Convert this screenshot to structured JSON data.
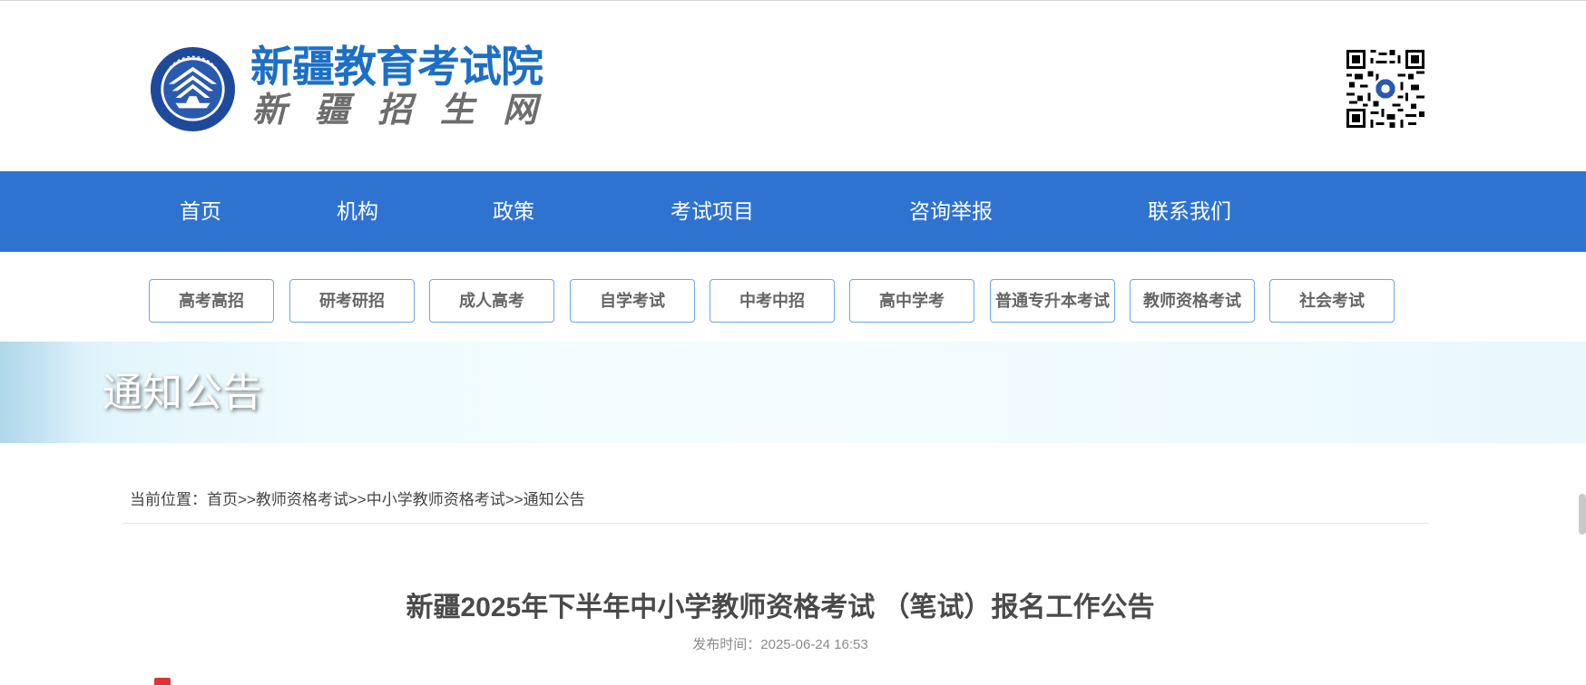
{
  "header": {
    "site_title": "新疆教育考试院",
    "site_subtitle": "新疆招生网",
    "emblem_icon": "exam-institute-emblem-icon",
    "qr_icon": "qr-code-icon"
  },
  "nav": {
    "items": [
      {
        "label": "首页"
      },
      {
        "label": "机构"
      },
      {
        "label": "政策"
      },
      {
        "label": "考试项目"
      },
      {
        "label": "咨询举报"
      },
      {
        "label": "联系我们"
      }
    ],
    "bg_color": "#2f73d1"
  },
  "categories": [
    {
      "label": "高考高招"
    },
    {
      "label": "研考研招"
    },
    {
      "label": "成人高考"
    },
    {
      "label": "自学考试"
    },
    {
      "label": "中考中招"
    },
    {
      "label": "高中学考"
    },
    {
      "label": "普通专升本考试"
    },
    {
      "label": "教师资格考试"
    },
    {
      "label": "社会考试"
    }
  ],
  "banner": {
    "title": "通知公告"
  },
  "breadcrumb": {
    "prefix": "当前位置：",
    "sep": ">>",
    "items": [
      "首页",
      "教师资格考试",
      "中小学教师资格考试",
      "通知公告"
    ]
  },
  "article": {
    "title": "新疆2025年下半年中小学教师资格考试 （笔试）报名工作公告",
    "publish_label": "发布时间：",
    "publish_time": "2025-06-24 16:53"
  }
}
